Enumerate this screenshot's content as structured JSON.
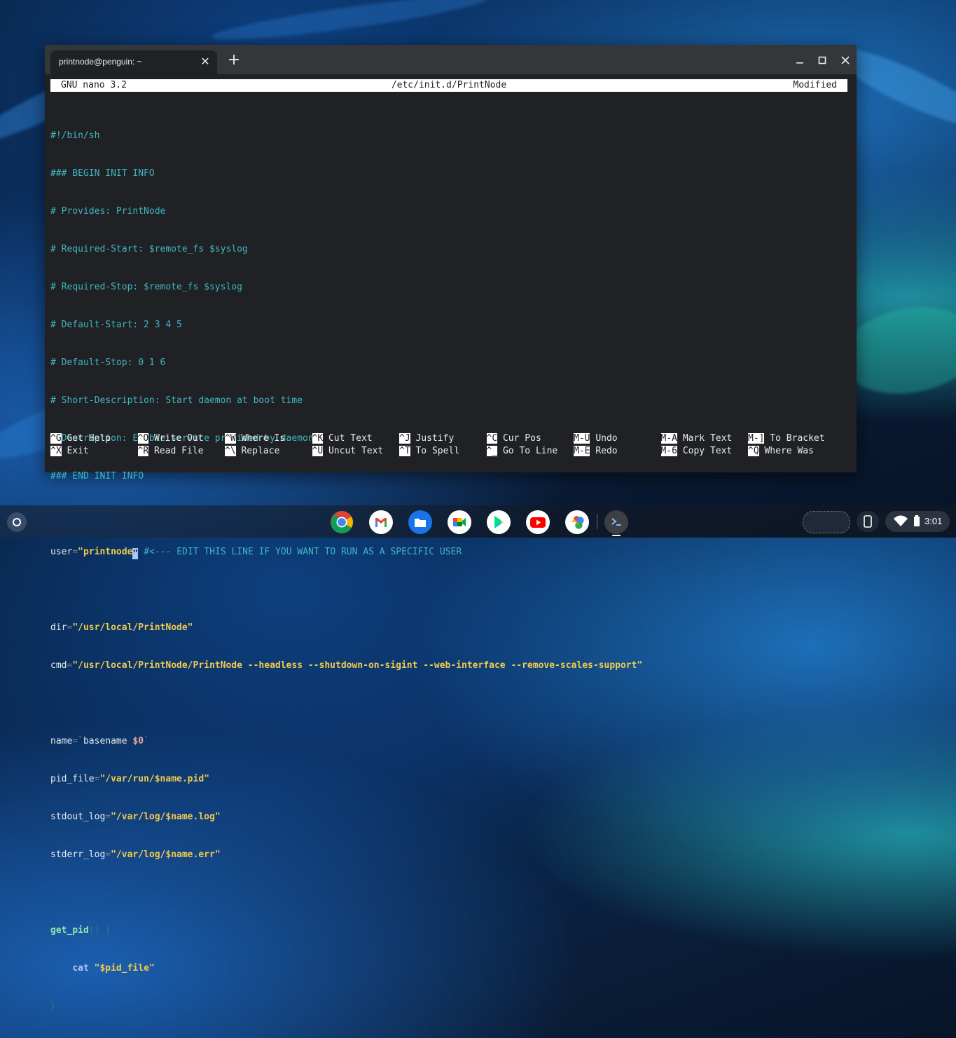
{
  "window": {
    "tab_title": "printnode@penguin: ~",
    "tab_close": "✕",
    "new_tab": "+"
  },
  "nano": {
    "version": "GNU nano 3.2",
    "filename": "/etc/init.d/PrintNode",
    "status": "Modified"
  },
  "file": {
    "l1": "#!/bin/sh",
    "l2": "### BEGIN INIT INFO",
    "l3": "# Provides: PrintNode",
    "l4": "# Required-Start: $remote_fs $syslog",
    "l5": "# Required-Stop: $remote_fs $syslog",
    "l6": "# Default-Start: 2 3 4 5",
    "l7": "# Default-Stop: 0 1 6",
    "l8": "# Short-Description: Start daemon at boot time",
    "l9": "# Description: Enable service provided by daemon.",
    "l10": "### END INIT INFO",
    "user_name": "user",
    "user_eq": "=",
    "user_val_a": "\"printnode",
    "user_val_b": "\"",
    "user_comment": " #<--- EDIT THIS LINE IF YOU WANT TO RUN AS A SPECIFIC USER",
    "dir_name": "dir",
    "dir_eq": "=",
    "dir_val": "\"/usr/local/PrintNode\"",
    "cmd_name": "cmd",
    "cmd_eq": "=",
    "cmd_val": "\"/usr/local/PrintNode/PrintNode --headless --shutdown-on-sigint --web-interface --remove-scales-support\"",
    "name_name": "name",
    "name_eq": "=`",
    "name_cmd": "basename ",
    "name_var": "$0",
    "name_end": "`",
    "pid_name": "pid_file",
    "pid_eq": "=",
    "pid_val": "\"/var/run/$name.pid\"",
    "out_name": "stdout_log",
    "out_eq": "=",
    "out_val": "\"/var/log/$name.log\"",
    "err_name": "stderr_log",
    "err_eq": "=",
    "err_val": "\"/var/log/$name.err\"",
    "fn_name": "get_pid",
    "fn_paren": "() {",
    "cat_indent": "    ",
    "cat_kw": "cat",
    "cat_arg": " \"$pid_file\"",
    "close_brace": "}"
  },
  "shortcuts": [
    {
      "key": "^G",
      "label": "Get Help"
    },
    {
      "key": "^O",
      "label": "Write Out"
    },
    {
      "key": "^W",
      "label": "Where Is"
    },
    {
      "key": "^K",
      "label": "Cut Text"
    },
    {
      "key": "^J",
      "label": "Justify"
    },
    {
      "key": "^C",
      "label": "Cur Pos"
    },
    {
      "key": "M-U",
      "label": "Undo"
    },
    {
      "key": "M-A",
      "label": "Mark Text"
    },
    {
      "key": "M-]",
      "label": "To Bracket"
    },
    {
      "key": "^X",
      "label": "Exit"
    },
    {
      "key": "^R",
      "label": "Read File"
    },
    {
      "key": "^\\",
      "label": "Replace"
    },
    {
      "key": "^U",
      "label": "Uncut Text"
    },
    {
      "key": "^T",
      "label": "To Spell"
    },
    {
      "key": "^_",
      "label": "Go To Line"
    },
    {
      "key": "M-E",
      "label": "Redo"
    },
    {
      "key": "M-6",
      "label": "Copy Text"
    },
    {
      "key": "^Q",
      "label": "Where Was"
    }
  ],
  "shelf": {
    "apps": [
      "chrome-icon",
      "gmail-icon",
      "files-icon",
      "meet-icon",
      "play-store-icon",
      "youtube-icon",
      "photos-icon",
      "terminal-icon"
    ],
    "time": "3:01"
  }
}
